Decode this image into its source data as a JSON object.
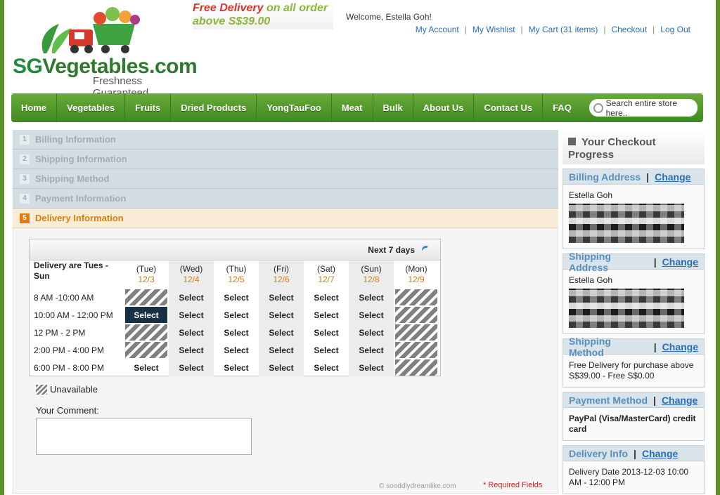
{
  "brand": {
    "logo_sg": "SG",
    "logo_rest": "Vegetables.com",
    "tagline": "Freshness Guaranteed"
  },
  "promo": {
    "line1_a": "Free Delivery",
    "line1_b": " on all order",
    "line2": "above S$39.00"
  },
  "header": {
    "welcome": "Welcome, Estella Goh!",
    "links": [
      "My Account",
      "My Wishlist",
      "My Cart (31 items)",
      "Checkout",
      "Log Out"
    ]
  },
  "nav": {
    "items": [
      "Home",
      "Vegetables",
      "Fruits",
      "Dried Products",
      "YongTauFoo",
      "Meat",
      "Bulk",
      "About Us",
      "Contact Us",
      "FAQ"
    ],
    "search_placeholder": "Search entire store here.."
  },
  "steps": [
    {
      "num": "1",
      "label": "Billing Information"
    },
    {
      "num": "2",
      "label": "Shipping Information"
    },
    {
      "num": "3",
      "label": "Shipping Method"
    },
    {
      "num": "4",
      "label": "Payment Information"
    },
    {
      "num": "5",
      "label": "Delivery Information"
    }
  ],
  "delivery": {
    "next_label": "Next 7 days",
    "corner_label": "Delivery are Tues - Sun",
    "days": [
      {
        "day": "(Tue)",
        "date": "12/3"
      },
      {
        "day": "(Wed)",
        "date": "12/4"
      },
      {
        "day": "(Thu)",
        "date": "12/5"
      },
      {
        "day": "(Fri)",
        "date": "12/6"
      },
      {
        "day": "(Sat)",
        "date": "12/7"
      },
      {
        "day": "(Sun)",
        "date": "12/8"
      },
      {
        "day": "(Mon)",
        "date": "12/9"
      }
    ],
    "select_label": "Select",
    "slots": [
      {
        "time": "8 AM -10:00 AM",
        "cells": [
          "unavailable",
          "select",
          "select",
          "select",
          "select",
          "select",
          "unavailable"
        ]
      },
      {
        "time": "10:00 AM - 12:00 PM",
        "cells": [
          "chosen",
          "select",
          "select",
          "select",
          "select",
          "select",
          "unavailable"
        ]
      },
      {
        "time": "12 PM - 2 PM",
        "cells": [
          "unavailable",
          "select",
          "select",
          "select",
          "select",
          "select",
          "unavailable"
        ]
      },
      {
        "time": "2:00 PM - 4:00 PM",
        "cells": [
          "unavailable",
          "select",
          "select",
          "select",
          "select",
          "select",
          "unavailable"
        ]
      },
      {
        "time": "6:00 PM - 8:00 PM",
        "cells": [
          "select",
          "select",
          "select",
          "select",
          "select",
          "select",
          "unavailable"
        ]
      }
    ],
    "legend": "Unavailable",
    "comment_label": "Your Comment:",
    "credit": "© sooddlydreamlike.com",
    "required": "* Required Fields"
  },
  "sidebar": {
    "title": "Your Checkout Progress",
    "change_label": "Change",
    "billing": {
      "title": "Billing Address",
      "name": "Estella Goh"
    },
    "shipping": {
      "title": "Shipping Address",
      "name": "Estella Goh"
    },
    "method": {
      "title": "Shipping Method",
      "text": "Free Delivery for purchase above S$39.00 - Free S$0.00"
    },
    "payment": {
      "title": "Payment Method",
      "text": "PayPal (Visa/MasterCard) credit card"
    },
    "delivery": {
      "title": "Delivery Info",
      "text": "Delivery Date 2013-12-03 10:00 AM - 12:00 PM"
    }
  }
}
